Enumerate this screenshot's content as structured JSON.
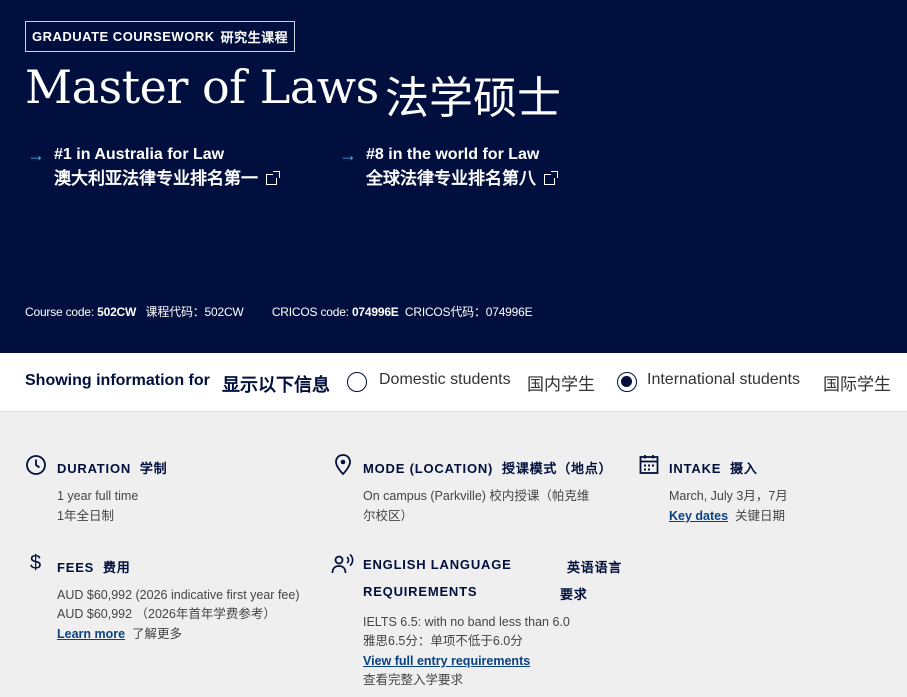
{
  "hero": {
    "badge_en": "GRADUATE COURSEWORK",
    "badge_zh": "研究生课程",
    "title_en": "Master of Laws",
    "title_zh": "法学硕士",
    "rank1_en": "#1 in Australia for Law",
    "rank1_zh": "澳大利亚法律专业排名第一",
    "rank2_en": "#8 in the world for Law",
    "rank2_zh": "全球法律专业排名第八",
    "course_code_label": "Course code:",
    "course_code": "502CW",
    "course_code_zh": "课程代码：502CW",
    "cricos_label": "CRICOS code:",
    "cricos_code": "074996E",
    "cricos_zh": "CRICOS代码：074996E"
  },
  "showing": {
    "label_en": "Showing information for",
    "label_zh": "显示以下信息",
    "domestic_en": "Domestic students",
    "domestic_zh": "国内学生",
    "international_en": "International students",
    "international_zh": "国际学生",
    "selected": "international"
  },
  "duration": {
    "head_en": "DURATION",
    "head_zh": "学制",
    "line1": "1 year full time",
    "line2": "1年全日制"
  },
  "mode": {
    "head_en": "MODE (LOCATION)",
    "head_zh": "授课模式（地点）",
    "line1": "On campus (Parkville)  校内授课（帕克维",
    "line2": "尔校区）"
  },
  "intake": {
    "head_en": "INTAKE",
    "head_zh": "摄入",
    "line1": "March, July  3月，7月",
    "link": "Key dates",
    "link_zh": "关键日期"
  },
  "fees": {
    "head_en": "FEES",
    "head_zh": "费用",
    "line1": "AUD $60,992 (2026 indicative first year fee)",
    "line2": "AUD $60,992 （2026年首年学费参考）",
    "link": "Learn more",
    "link_zh": "了解更多"
  },
  "english": {
    "head_en1": "ENGLISH LANGUAGE",
    "head_en2": "REQUIREMENTS",
    "head_zh1": "英语语言",
    "head_zh2": "要求",
    "line1": "IELTS 6.5: with no band less than 6.0",
    "line2": "雅思6.5分：单项不低于6.0分",
    "link": "View full entry requirements",
    "link_zh": "查看完整入学要求"
  }
}
